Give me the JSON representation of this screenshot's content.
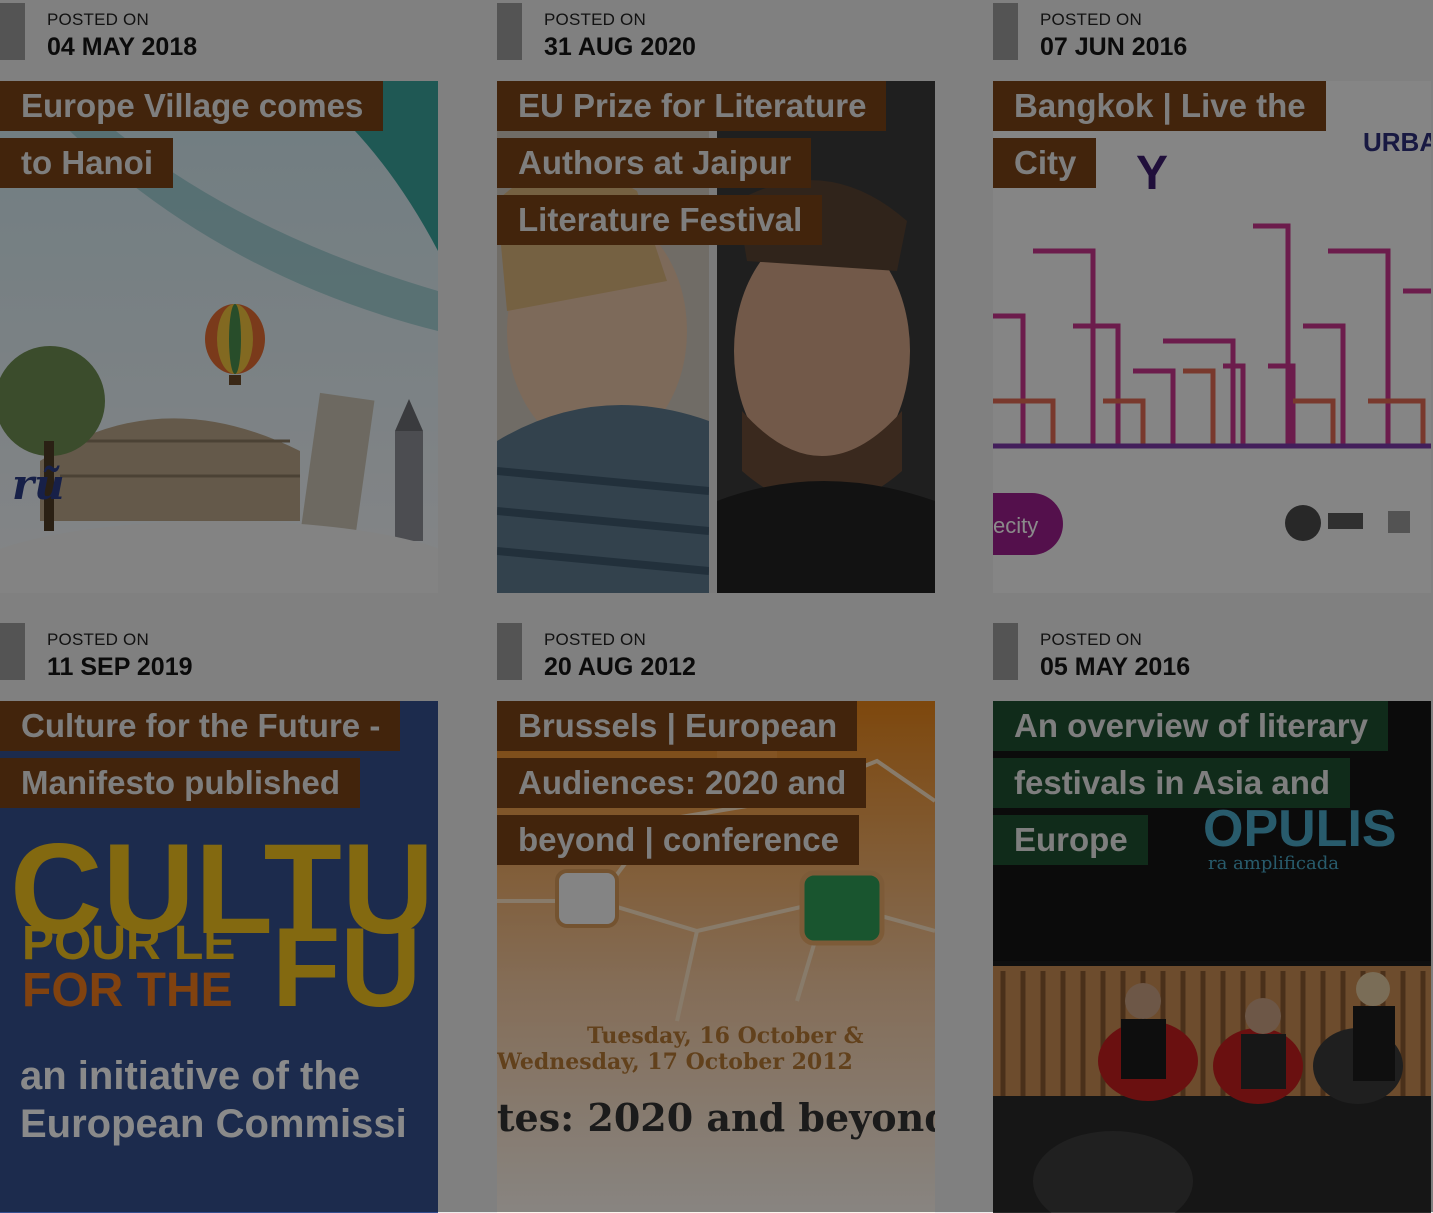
{
  "posted_label": "POSTED ON",
  "cards": [
    {
      "date": "04 MAY 2018",
      "title": "Europe Village comes to Hanoi",
      "art_text": "rũ"
    },
    {
      "date": "31 AUG 2020",
      "title": "EU Prize for Literature Authors at Jaipur Literature Festival"
    },
    {
      "date": "07 JUN 2016",
      "title": "Bangkok | Live the City",
      "art_text": {
        "brand": "URBA",
        "y": "Y",
        "pill": "ecity"
      }
    },
    {
      "date": "11 SEP 2019",
      "title": "Culture for the Future - Manifesto published",
      "art_text": {
        "big1": "CULTU",
        "pour": "POUR LE",
        "forthe": "FOR THE",
        "fu": "FU",
        "init1": "an initiative of the",
        "init2": "European Commissi"
      }
    },
    {
      "date": "20 AUG 2012",
      "title": "Brussels | European Audiences: 2020 and beyond | conference",
      "art_text": {
        "l1": "Tuesday, 16 October &",
        "l2": "Wednesday, 17 October 2012",
        "l3": "tes: 2020 and beyond"
      }
    },
    {
      "date": "05 MAY 2016",
      "title": "An overview of literary festivals in Asia and Europe",
      "art_text": {
        "big": "OPULIS",
        "small": "ra amplificada"
      }
    }
  ],
  "colors": {
    "title_brown": "#7b4417",
    "title_green": "#1f5131",
    "overlay": "rgba(0,0,0,0.46)"
  }
}
